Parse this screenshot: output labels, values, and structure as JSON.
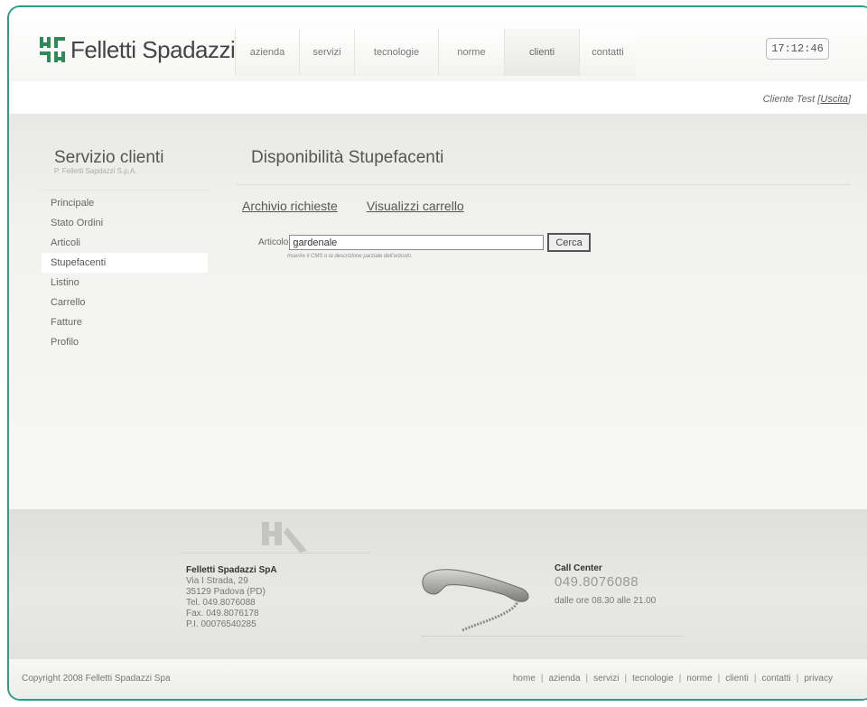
{
  "brand": {
    "name": "Felletti Spadazzi"
  },
  "nav": {
    "items": [
      {
        "label": "azienda",
        "width": 70
      },
      {
        "label": "servizi",
        "width": 60
      },
      {
        "label": "tecnologie",
        "width": 92
      },
      {
        "label": "norme",
        "width": 72
      },
      {
        "label": "clienti",
        "width": 82
      },
      {
        "label": "contatti",
        "width": 62
      }
    ],
    "active": "clienti"
  },
  "clock": {
    "time": "17:12:46"
  },
  "userbar": {
    "user": "Cliente Test",
    "logout": "Uscita"
  },
  "sidebar": {
    "title": "Servizio clienti",
    "subtitle": "P. Felletti Sapdazzi S.p.A.",
    "items": [
      {
        "label": "Principale"
      },
      {
        "label": "Stato Ordini"
      },
      {
        "label": "Articoli"
      },
      {
        "label": "Stupefacenti"
      },
      {
        "label": "Listino"
      },
      {
        "label": "Carrello"
      },
      {
        "label": "Fatture"
      },
      {
        "label": "Profilo"
      }
    ],
    "active": "Stupefacenti"
  },
  "main": {
    "title": "Disponibilità Stupefacenti",
    "links": [
      "Archivio richieste",
      "Visualizzi carrello"
    ],
    "form": {
      "label": "Articolo",
      "value": "gardenale",
      "button": "Cerca",
      "hint": "Inserire il CMS o la descrizione parziale dell'articolo."
    }
  },
  "footer": {
    "company": {
      "name": "Felletti Spadazzi SpA",
      "address": "Via I Strada, 29",
      "city": "35129 Padova (PD)",
      "tel": "Tel. 049.8076088",
      "fax": "Fax. 049.8076178",
      "vat": "P.I. 00076540285"
    },
    "callcenter": {
      "label": "Call Center",
      "number": "049.8076088",
      "hours": "dalle ore 08.30 alle 21.00"
    },
    "copyright": "Copyright 2008 Felletti Spadazzi Spa",
    "links": [
      "home",
      "azienda",
      "servizi",
      "tecnologie",
      "norme",
      "clienti",
      "contatti",
      "privacy"
    ]
  },
  "colors": {
    "frame": "#2a9d86",
    "logo_green": "#2e8b57"
  }
}
